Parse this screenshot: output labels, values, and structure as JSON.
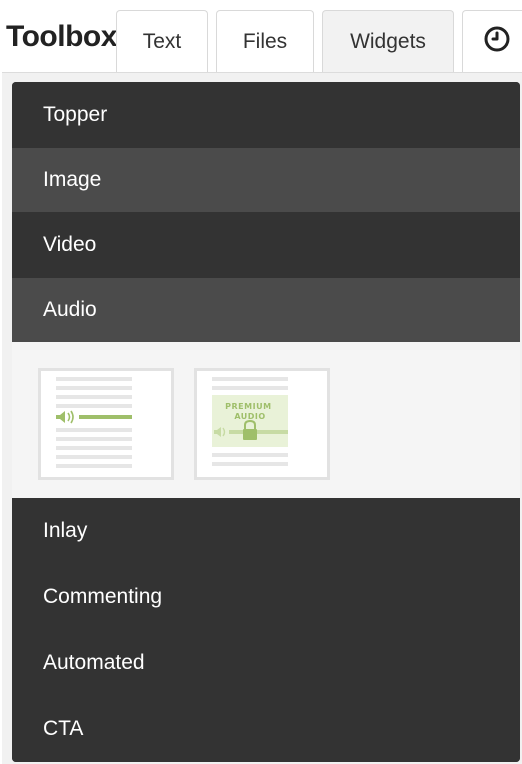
{
  "header": {
    "title": "Toolbox",
    "tabs": [
      {
        "label": "Text"
      },
      {
        "label": "Files"
      },
      {
        "label": "Widgets"
      }
    ],
    "history_icon": "clock-icon",
    "active_tab": "Widgets"
  },
  "widgets": {
    "items": [
      {
        "label": "Topper"
      },
      {
        "label": "Image"
      },
      {
        "label": "Video"
      },
      {
        "label": "Audio"
      },
      {
        "label": "Inlay"
      },
      {
        "label": "Commenting"
      },
      {
        "label": "Automated"
      },
      {
        "label": "CTA"
      }
    ],
    "expanded": "Audio",
    "audio_options": [
      {
        "name": "audio-widget",
        "icon": "speaker-icon"
      },
      {
        "name": "premium-audio-widget",
        "icon": "lock-icon",
        "label": "PREMIUM AUDIO"
      }
    ]
  },
  "colors": {
    "row_dark": "#333333",
    "row_light": "#4b4b4b",
    "accent_green": "#9fbf6a"
  }
}
